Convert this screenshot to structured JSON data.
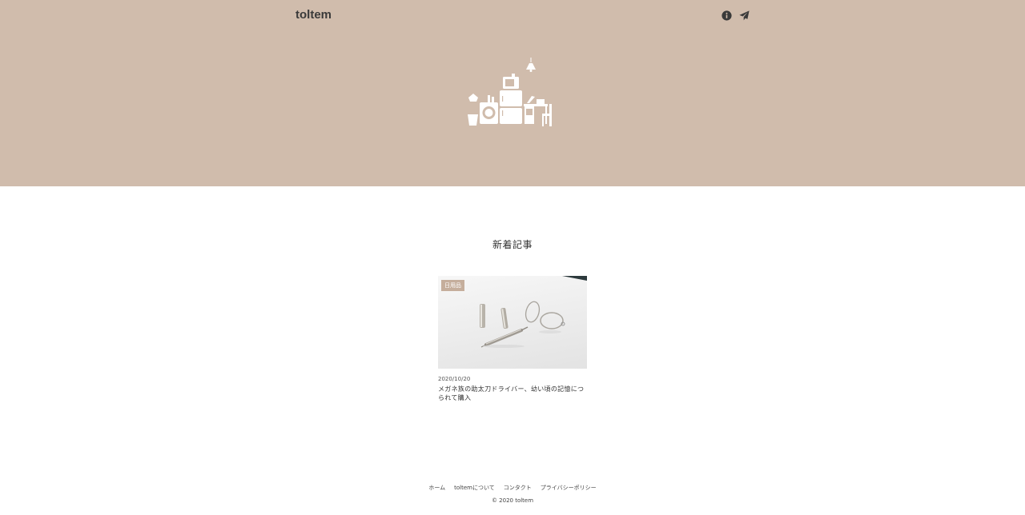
{
  "header": {
    "site_title": "toltem",
    "icons": [
      "info-icon",
      "paper-plane-icon"
    ]
  },
  "colors": {
    "hero_background": "#d0bcac",
    "badge_background": "#c5ae9c"
  },
  "main": {
    "section_title": "新着記事",
    "posts": [
      {
        "category": "日用品",
        "date": "2020/10/20",
        "title": "メガネ族の助太刀ドライバー、幼い頃の記憶につられて購入"
      }
    ]
  },
  "footer": {
    "links": [
      "ホーム",
      "toltemについて",
      "コンタクト",
      "プライバシーポリシー"
    ],
    "copyright": "© 2020 toltem"
  }
}
